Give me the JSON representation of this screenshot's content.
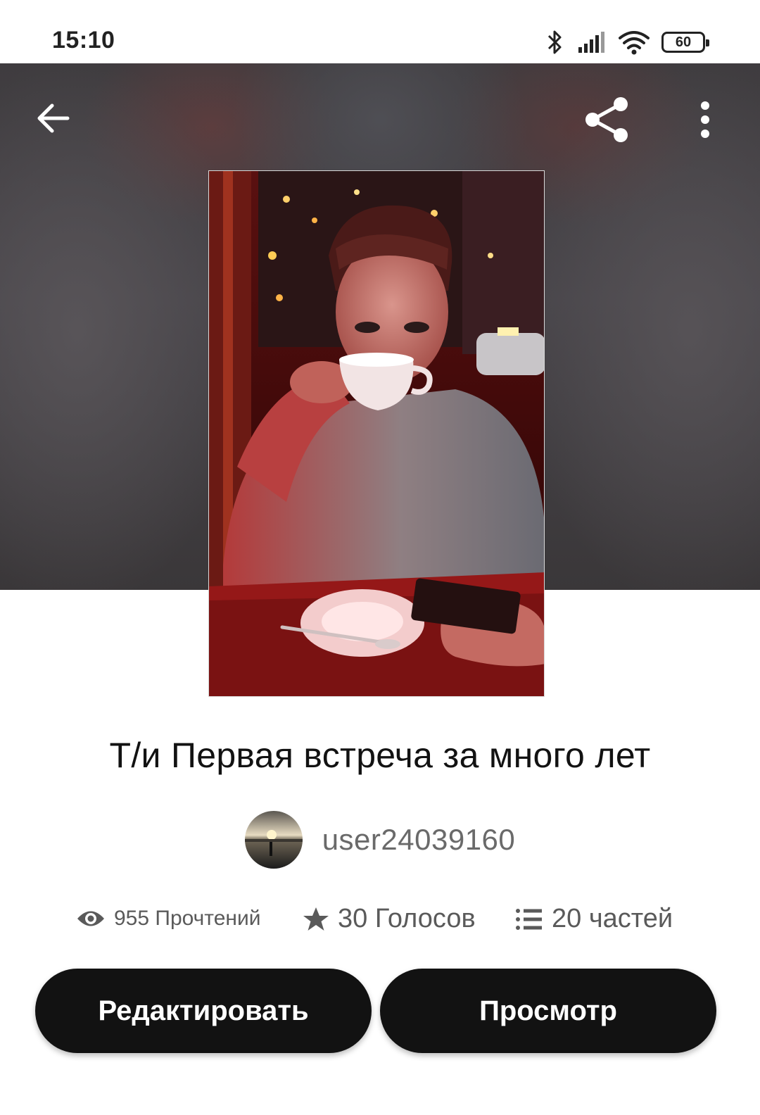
{
  "status_bar": {
    "time": "15:10",
    "battery": "60",
    "icons": [
      "bluetooth-icon",
      "signal-icon",
      "wifi-icon",
      "battery-icon"
    ]
  },
  "header": {
    "back_icon": "arrow-left-icon",
    "share_icon": "share-icon",
    "more_icon": "more-vertical-icon"
  },
  "story": {
    "title": "Т/и Первая встреча за много лет",
    "author": "user24039160"
  },
  "stats": {
    "reads": "955 Прочтений",
    "votes": "30 Голосов",
    "parts": "20 частей"
  },
  "actions": {
    "edit_label": "Редактировать",
    "view_label": "Просмотр"
  },
  "colors": {
    "button_bg": "#121212",
    "button_text": "#ffffff",
    "meta_text": "#5a5a5a"
  }
}
